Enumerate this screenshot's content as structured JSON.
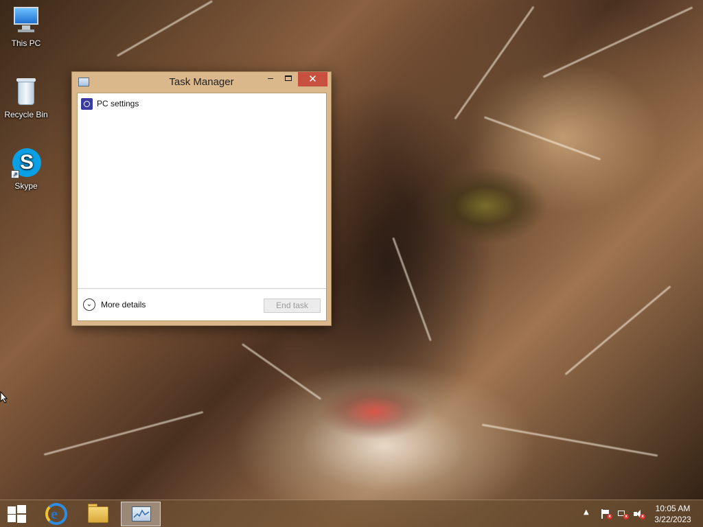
{
  "desktop": {
    "icons": [
      {
        "label": "This PC"
      },
      {
        "label": "Recycle Bin"
      },
      {
        "label": "Skype"
      }
    ]
  },
  "task_manager": {
    "title": "Task Manager",
    "controls": {
      "minimize": "–",
      "close": "✕"
    },
    "apps": [
      {
        "name": "PC settings",
        "icon": "pc-settings-icon"
      }
    ],
    "footer": {
      "more_details_label": "More details",
      "end_task_label": "End task"
    }
  },
  "taskbar": {
    "pinned": [
      {
        "name": "Internet Explorer",
        "icon": "ie-icon"
      },
      {
        "name": "File Explorer",
        "icon": "folder-icon"
      },
      {
        "name": "Task Manager",
        "icon": "task-manager-icon",
        "active": true
      }
    ],
    "tray": {
      "icons": [
        "action-center-flag-icon",
        "network-icon",
        "volume-muted-icon"
      ]
    },
    "clock": {
      "time": "10:05 AM",
      "date": "3/22/2023"
    }
  },
  "colors": {
    "close_button": "#c7503f",
    "window_frame": "#dab88c",
    "taskbar": "#6e5032"
  }
}
